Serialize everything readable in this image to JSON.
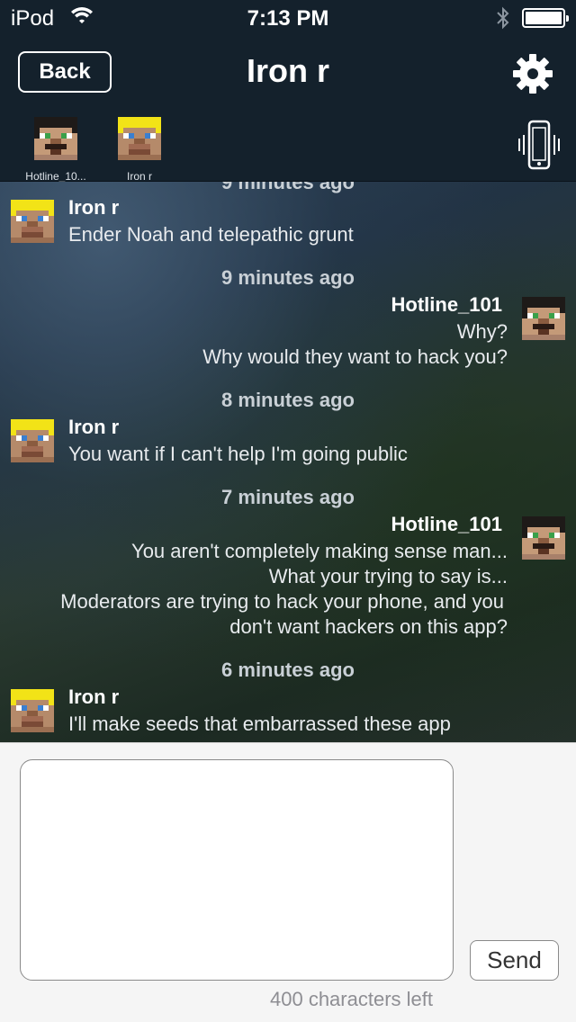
{
  "status_bar": {
    "carrier": "iPod",
    "time": "7:13 PM"
  },
  "nav": {
    "back_label": "Back",
    "title": "Iron r"
  },
  "participants": [
    {
      "name": "Hotline_10..."
    },
    {
      "name": "Iron r"
    }
  ],
  "messages": {
    "top_cut_timestamp": "9 minutes ago",
    "groups": [
      {
        "sender": "Iron r",
        "lines": [
          "Ender Noah and telepathic grunt"
        ]
      },
      {
        "timestamp": "9 minutes ago",
        "sender": "Hotline_101",
        "lines": [
          "Why?",
          "Why would they want to hack you?"
        ]
      },
      {
        "timestamp": "8 minutes ago",
        "sender": "Iron r",
        "lines": [
          "You want if I can't help I'm going public"
        ]
      },
      {
        "timestamp": "7 minutes ago",
        "sender": "Hotline_101",
        "lines": [
          "You aren't completely making sense man...",
          "What your trying to say is...",
          "Moderators are trying to hack your phone, and you",
          "don't want hackers on this app?"
        ]
      },
      {
        "timestamp": "6 minutes ago",
        "sender": "Iron r",
        "lines": [
          "I'll make seeds that  embarrassed these app"
        ]
      }
    ]
  },
  "compose": {
    "input_value": "",
    "send_label": "Send",
    "chars_left": "400 characters left"
  },
  "colors": {
    "topbar": "#14212c",
    "compose_bg": "#f5f5f5"
  },
  "icons": [
    "wifi-icon",
    "bluetooth-icon",
    "battery-icon",
    "gear-icon",
    "vibrate-phone-icon"
  ]
}
